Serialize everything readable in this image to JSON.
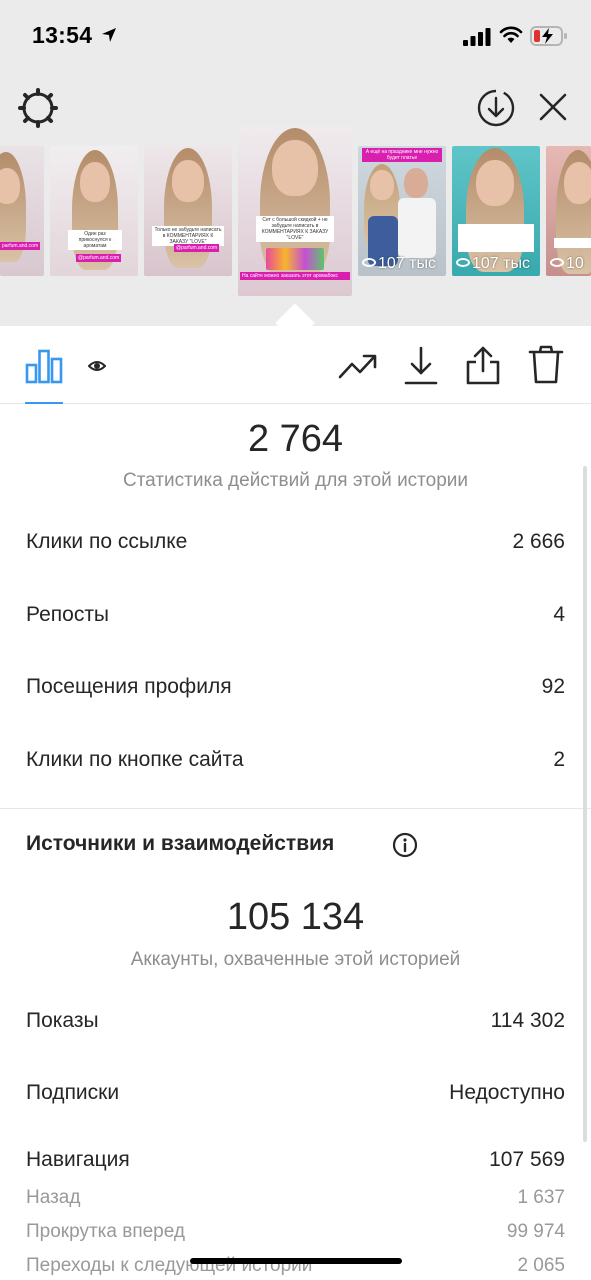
{
  "status_bar": {
    "time": "13:54"
  },
  "icons": {
    "location": "location-arrow-icon",
    "signal": "cellular-signal-icon",
    "wifi": "wifi-icon",
    "battery": "battery-charging-icon",
    "settings": "gear-icon",
    "download": "download-circle-icon",
    "close": "close-icon",
    "insights": "bar-chart-icon",
    "viewers": "eye-icon",
    "promote": "trending-up-icon",
    "save": "download-icon",
    "share": "share-icon",
    "delete": "trash-icon",
    "info": "info-icon"
  },
  "colors": {
    "accent": "#3897f0",
    "tag_pink": "#d81fae",
    "text_primary": "#262626",
    "text_secondary": "#8e8e8e"
  },
  "stories": [
    {
      "id": "s1",
      "caption": "",
      "tags": [
        "parfum.and.com"
      ],
      "views": ""
    },
    {
      "id": "s2",
      "caption": "Один раз прикоснулся к ароматам",
      "tags": [
        "@parfum.and.com"
      ],
      "views": ""
    },
    {
      "id": "s3",
      "caption": "Только не забудьте написать в КОММЕНТАРИЯХ К ЗАКАЗУ \"LOVE\"",
      "tags": [
        "@parfum.and.com"
      ],
      "views": ""
    },
    {
      "id": "s4",
      "caption": "Сет с большой скидкой + не забудьте написать в КОММЕНТАРИЯХ К ЗАКАЗУ \"LOVE\"",
      "tags": [
        "На сайте можно заказать этот аромабокс"
      ],
      "views": ""
    },
    {
      "id": "s5",
      "caption": "А ещё на празднике мне нужно будет платье",
      "tags": [],
      "views": "107 тыс"
    },
    {
      "id": "s6",
      "caption": "",
      "tags": [],
      "views": "107 тыс"
    },
    {
      "id": "s7",
      "caption": "",
      "tags": [],
      "views": "10"
    }
  ],
  "activity": {
    "total": "2 764",
    "subtitle": "Статистика действий для этой истории",
    "rows": [
      {
        "label": "Клики по ссылке",
        "value": "2 666"
      },
      {
        "label": "Репосты",
        "value": "4"
      },
      {
        "label": "Посещения профиля",
        "value": "92"
      },
      {
        "label": "Клики по кнопке сайта",
        "value": "2"
      }
    ]
  },
  "discovery": {
    "title": "Источники и взаимодействия",
    "total": "105 134",
    "subtitle": "Аккаунты, охваченные этой историей",
    "rows": [
      {
        "label": "Показы",
        "value": "114 302"
      },
      {
        "label": "Подписки",
        "value": "Недоступно"
      },
      {
        "label": "Навигация",
        "value": "107 569"
      }
    ],
    "navigation_rows": [
      {
        "label": "Назад",
        "value": "1 637"
      },
      {
        "label": "Прокрутка вперед",
        "value": "99 974"
      },
      {
        "label": "Переходы к следующей истории",
        "value": "2 065"
      }
    ]
  }
}
